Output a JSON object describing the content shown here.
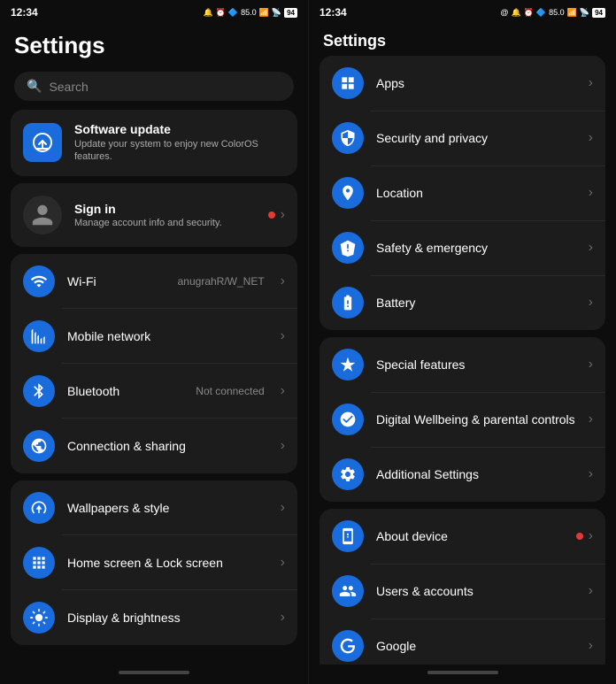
{
  "left": {
    "status_bar": {
      "time": "12:34",
      "icons": "📶"
    },
    "title": "Settings",
    "search": {
      "placeholder": "Search"
    },
    "software_update": {
      "title": "Software update",
      "subtitle": "Update your system to enjoy new ColorOS features."
    },
    "sign_in": {
      "title": "Sign in",
      "subtitle": "Manage account info and security."
    },
    "items": [
      {
        "id": "wifi",
        "label": "Wi-Fi",
        "value": "anugrahR/W_NET",
        "icon": "wifi"
      },
      {
        "id": "mobile",
        "label": "Mobile network",
        "value": "",
        "icon": "mobile"
      },
      {
        "id": "bluetooth",
        "label": "Bluetooth",
        "value": "Not connected",
        "icon": "bluetooth"
      },
      {
        "id": "connection",
        "label": "Connection & sharing",
        "value": "",
        "icon": "connection"
      }
    ],
    "items2": [
      {
        "id": "wallpapers",
        "label": "Wallpapers & style",
        "icon": "wallpapers"
      },
      {
        "id": "homescreen",
        "label": "Home screen & Lock screen",
        "icon": "homescreen"
      },
      {
        "id": "display",
        "label": "Display & brightness",
        "icon": "display"
      }
    ]
  },
  "right": {
    "status_bar": {
      "time": "12:34"
    },
    "title": "Settings",
    "groups": [
      {
        "id": "group1",
        "items": [
          {
            "id": "apps",
            "label": "Apps",
            "icon": "apps"
          },
          {
            "id": "security",
            "label": "Security and privacy",
            "icon": "security"
          },
          {
            "id": "location",
            "label": "Location",
            "icon": "location"
          },
          {
            "id": "safety",
            "label": "Safety & emergency",
            "icon": "safety"
          },
          {
            "id": "battery",
            "label": "Battery",
            "icon": "battery"
          }
        ]
      },
      {
        "id": "group2",
        "items": [
          {
            "id": "special",
            "label": "Special features",
            "icon": "special"
          },
          {
            "id": "wellbeing",
            "label": "Digital Wellbeing & parental controls",
            "icon": "wellbeing"
          },
          {
            "id": "additional",
            "label": "Additional Settings",
            "icon": "additional"
          }
        ]
      },
      {
        "id": "group3",
        "items": [
          {
            "id": "about",
            "label": "About device",
            "icon": "about",
            "has_dot": true
          },
          {
            "id": "users",
            "label": "Users & accounts",
            "icon": "users"
          },
          {
            "id": "google",
            "label": "Google",
            "icon": "google"
          }
        ]
      }
    ]
  }
}
